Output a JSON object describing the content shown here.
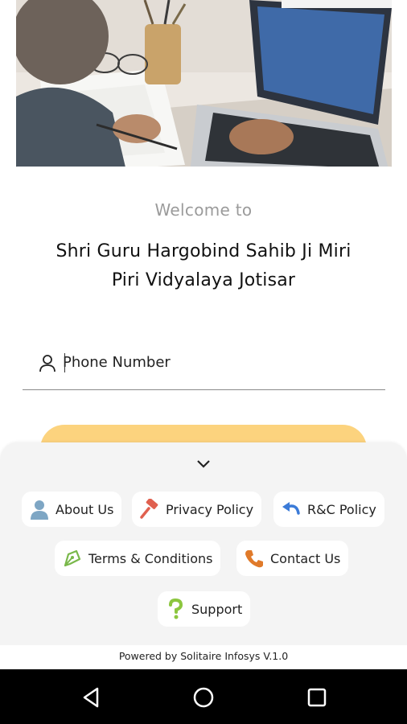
{
  "welcome": {
    "text": "Welcome to"
  },
  "school": {
    "line1": "Shri Guru Hargobind Sahib Ji Miri",
    "line2": "Piri Vidyalaya Jotisar"
  },
  "phone": {
    "placeholder": "Phone Number"
  },
  "chips": {
    "about": "About Us",
    "privacy": "Privacy Policy",
    "rc": "R&C Policy",
    "terms": "Terms & Conditions",
    "contact": "Contact Us",
    "support": "Support"
  },
  "footer": {
    "text": "Powered by Solitaire Infosys V.1.0"
  },
  "icons": {
    "user": "user-outline-icon",
    "about": "person-icon",
    "privacy": "gavel-icon",
    "rc": "undo-arrow-icon",
    "terms": "pen-nib-icon",
    "contact": "phone-icon",
    "support": "question-mark-icon",
    "chevron": "chevron-down-icon",
    "nav_back": "back-triangle-icon",
    "nav_home": "home-circle-icon",
    "nav_recent": "recent-square-icon"
  },
  "colors": {
    "login_button": "#fcd37e",
    "sheet_background": "#f4f4f4",
    "about_icon": "#7ea6c4",
    "privacy_icon": "#e0604f",
    "rc_icon": "#3b7bd8",
    "terms_icon": "#79b84a",
    "contact_icon": "#e07a2a",
    "support_icon": "#8cc63f"
  }
}
